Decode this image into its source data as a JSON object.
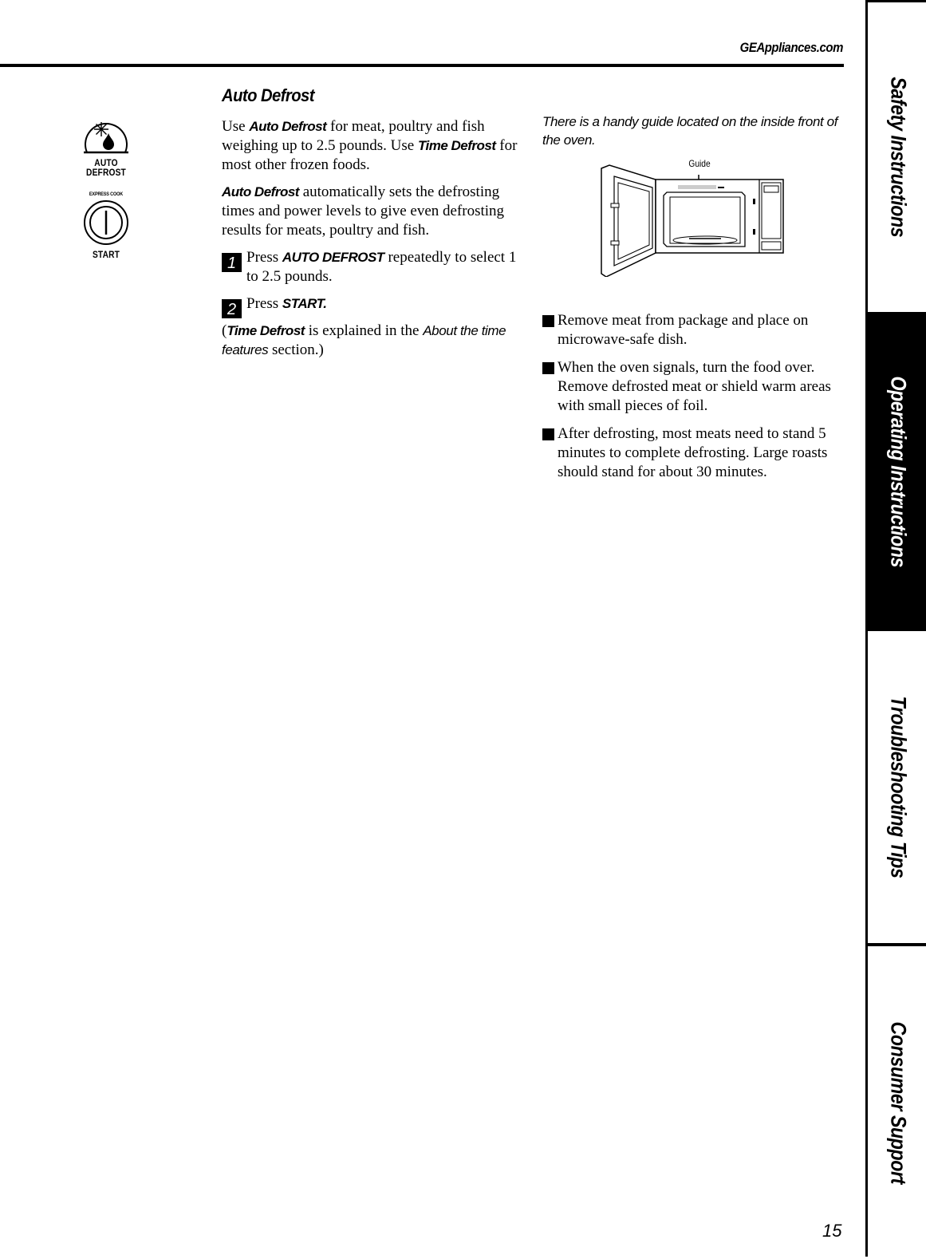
{
  "header": {
    "website": "GEAppliances.com"
  },
  "side_tabs": [
    {
      "label": "Safety Instructions",
      "active": false
    },
    {
      "label": "Operating Instructions",
      "active": true
    },
    {
      "label": "Troubleshooting Tips",
      "active": false
    },
    {
      "label": "Consumer Support",
      "active": false
    }
  ],
  "icons": {
    "auto_defrost": {
      "caption_line1": "AUTO",
      "caption_line2": "DEFROST"
    },
    "start": {
      "top_caption": "EXPRESS COOK",
      "caption": "START"
    }
  },
  "section": {
    "title": "Auto Defrost",
    "intro": {
      "p1_a": "Use ",
      "p1_b": "Auto Defrost",
      "p1_c": "  for meat, poultry and fish weighing up to 2.5 pounds. Use ",
      "p1_d": "Time Defrost",
      "p1_e": "  for most other frozen foods."
    },
    "para2": {
      "a": "Auto Defrost",
      "b": " automatically sets the defrosting times and power levels to give even defrosting results for meats, poultry and fish."
    },
    "steps": [
      {
        "number": "1",
        "pre": "Press ",
        "bold": "AUTO DEFROST",
        "post": " repeatedly to select 1 to 2.5 pounds."
      },
      {
        "number": "2",
        "pre": "Press ",
        "bold": "START.",
        "post": ""
      }
    ],
    "note": {
      "a": "(",
      "b": "Time Defrost",
      "c": " is explained in the ",
      "d": "About the time features",
      "e": " section.)"
    }
  },
  "guide": {
    "intro": "There is a handy guide located on the inside front of the oven.",
    "label": "Guide"
  },
  "bullets": [
    "Remove meat from package and place on microwave-safe dish.",
    "When the oven signals, turn the food over. Remove defrosted meat or shield warm areas with small pieces of foil.",
    "After defrosting, most meats need to stand 5 minutes to complete defrosting. Large roasts should stand for about 30 minutes."
  ],
  "page_number": "15"
}
